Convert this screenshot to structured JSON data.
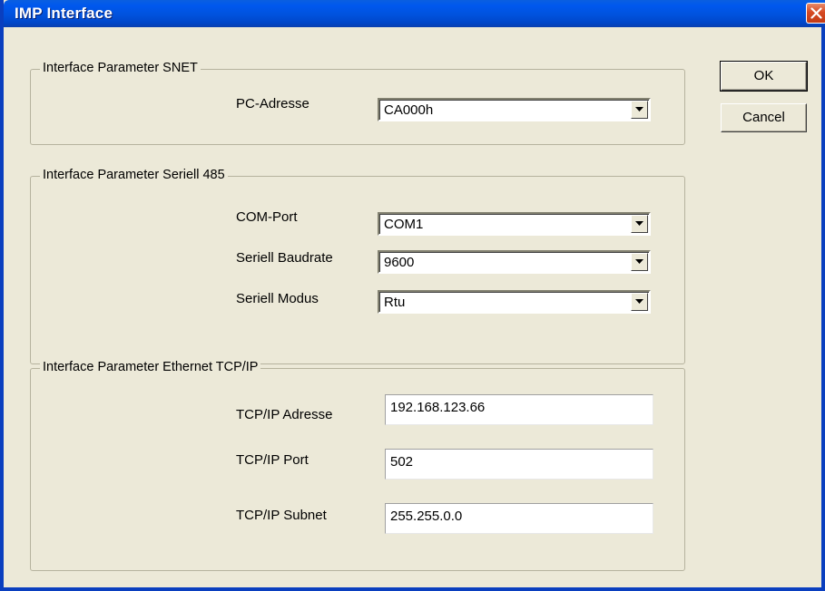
{
  "window": {
    "title": "IMP Interface"
  },
  "buttons": {
    "ok": "OK",
    "cancel": "Cancel"
  },
  "snet": {
    "caption": "Interface Parameter SNET",
    "pc_address_label": "PC-Adresse",
    "pc_address_value": "CA000h"
  },
  "serial": {
    "caption": "Interface Parameter Seriell 485",
    "com_port_label": "COM-Port",
    "com_port_value": "COM1",
    "baudrate_label": "Seriell Baudrate",
    "baudrate_value": "9600",
    "mode_label": "Seriell Modus",
    "mode_value": "Rtu"
  },
  "ethernet": {
    "caption": "Interface Parameter Ethernet TCP/IP",
    "address_label": "TCP/IP Adresse",
    "address_value": "192.168.123.66",
    "port_label": "TCP/IP Port",
    "port_value": "502",
    "subnet_label": "TCP/IP Subnet",
    "subnet_value": "255.255.0.0"
  },
  "icons": {
    "close": "close-icon",
    "dropdown": "chevron-down-icon"
  }
}
